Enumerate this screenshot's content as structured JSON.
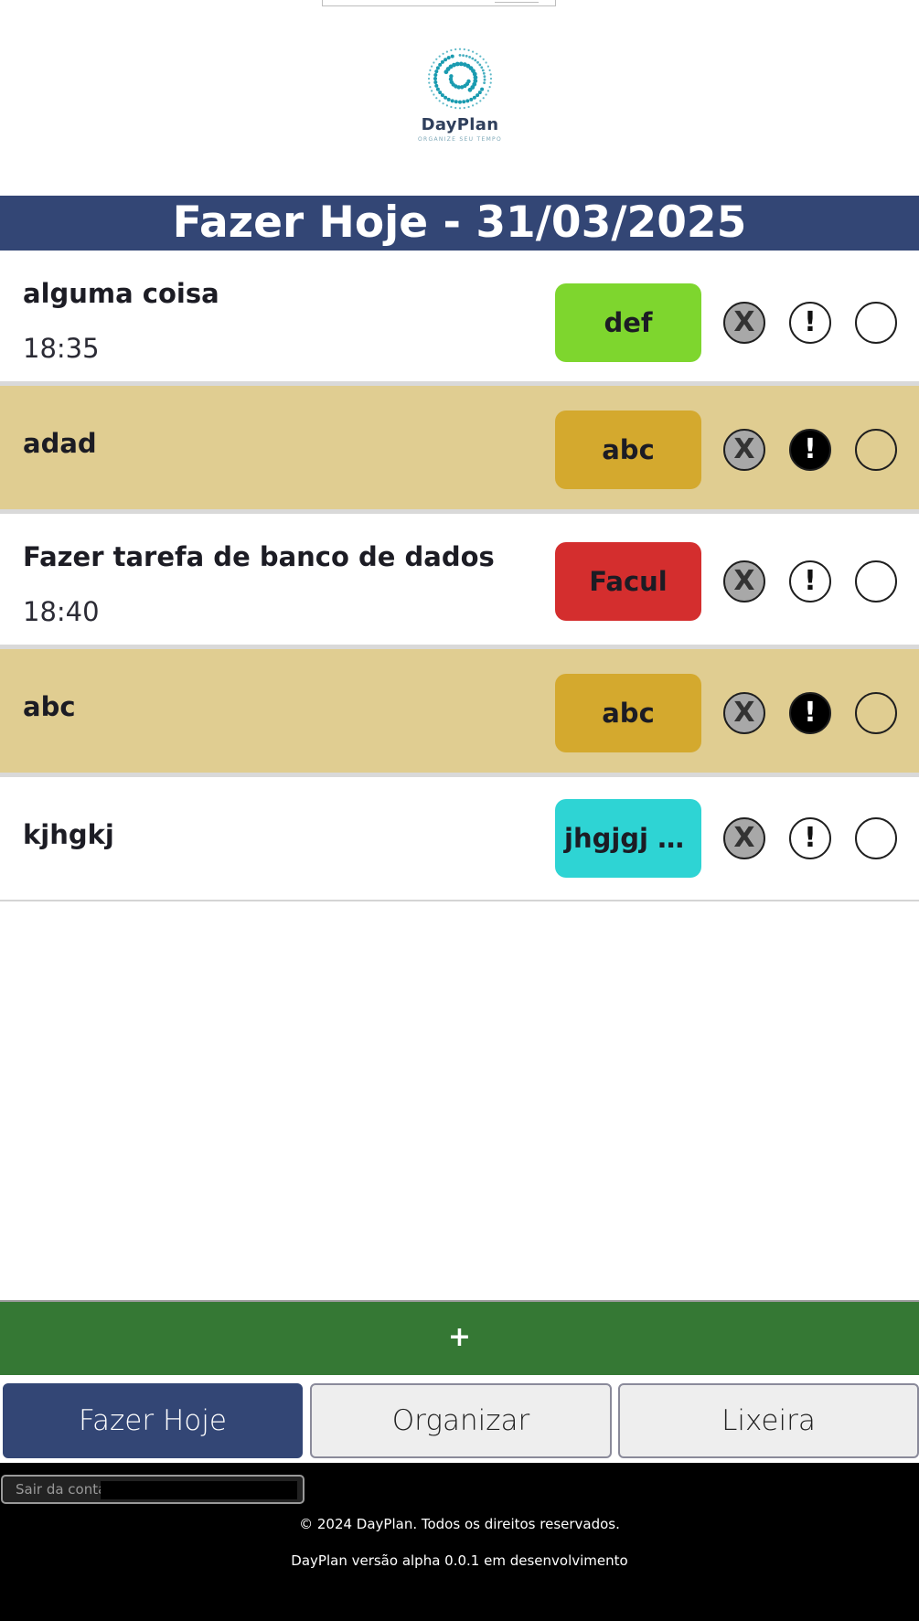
{
  "app": {
    "logo_name": "DayPlan",
    "logo_tagline": "ORGANIZE SEU TEMPO"
  },
  "header": {
    "title": "Fazer Hoje - 31/03/2025"
  },
  "tasks": [
    {
      "name": "alguma coisa",
      "time": "18:35",
      "tag": "def",
      "tag_color": "#7ed62e",
      "important": false
    },
    {
      "name": "adad",
      "time": "",
      "tag": "abc",
      "tag_color": "#d4a92e",
      "important": true
    },
    {
      "name": "Fazer tarefa de banco de dados",
      "time": "18:40",
      "tag": "Facul",
      "tag_color": "#d42e2e",
      "important": false
    },
    {
      "name": "abc",
      "time": "",
      "tag": "abc",
      "tag_color": "#d4a92e",
      "important": true
    },
    {
      "name": "kjhgkj",
      "time": "",
      "tag": "jhgjgj j...",
      "tag_color": "#2ed4d4",
      "important": false
    }
  ],
  "task_actions": {
    "delete_label": "X",
    "important_label": "!"
  },
  "add_button": {
    "label": "+"
  },
  "nav": {
    "tabs": [
      {
        "label": "Fazer Hoje",
        "active": true
      },
      {
        "label": "Organizar",
        "active": false
      },
      {
        "label": "Lixeira",
        "active": false
      }
    ]
  },
  "footer": {
    "logout_label": "Sair da conta",
    "copyright": "© 2024 DayPlan. Todos os direitos reservados.",
    "version": "DayPlan versão alpha 0.0.1 em desenvolvimento"
  },
  "colors": {
    "header_bg": "#334675",
    "important_row_bg": "#e0cd91",
    "add_button_bg": "#357834",
    "footer_bg": "#000000",
    "logo_teal": "#1a9bb0"
  }
}
